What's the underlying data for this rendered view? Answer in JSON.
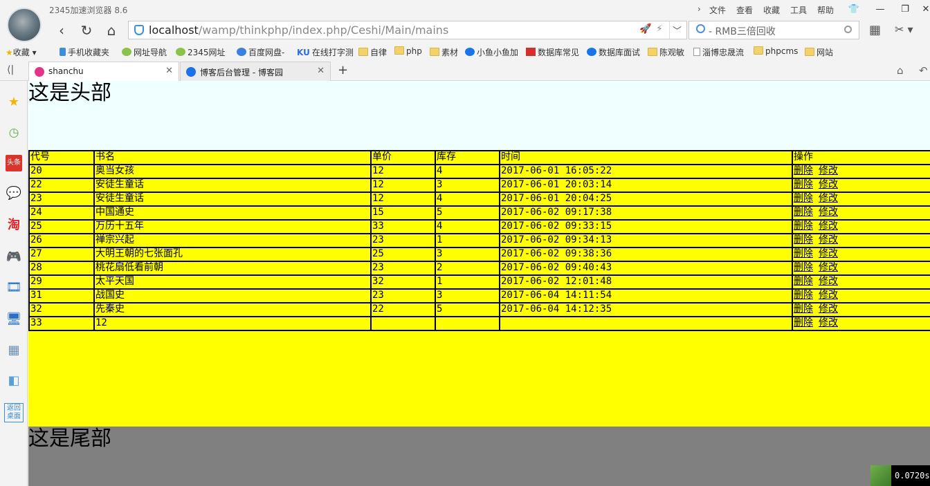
{
  "browser": {
    "title": "2345加速浏览器 8.6",
    "menu": [
      "文件",
      "查看",
      "收藏",
      "工具",
      "帮助"
    ],
    "address": {
      "host": "localhost",
      "path": "/wamp/thinkphp/index.php/Ceshi/Main/mains"
    },
    "search_placeholder": "- RMB三倍回收",
    "bookmarks": [
      "收藏",
      "手机收藏夹",
      "网址导航",
      "2345网址",
      "百度网盘-",
      "在线打字测",
      "自律",
      "php",
      "素材",
      "小鱼小鱼加",
      "数据库常见",
      "数据库面试",
      "陈观敏",
      "淄博忠晟流",
      "phpcms",
      "网站"
    ],
    "tabs": [
      {
        "label": "shanchu",
        "active": true
      },
      {
        "label": "博客后台管理 - 博客园",
        "active": false
      }
    ],
    "sidebar_icons": [
      "star-icon",
      "clock-icon",
      "toutiao-icon",
      "wechat-icon",
      "taobao-icon",
      "gamepad-icon",
      "video-icon",
      "computer-icon",
      "calculator-icon",
      "eraser-icon",
      "desktop-icon"
    ],
    "sidebar_desktop_label": "返回桌面"
  },
  "page": {
    "header_text": "这是头部",
    "footer_text": "这是尾部",
    "table": {
      "headers": [
        "代号",
        "书名",
        "单价",
        "库存",
        "时间",
        "操作"
      ],
      "rows": [
        [
          "20",
          "奥当女孩",
          "12",
          "4",
          "2017-06-01 16:05:22"
        ],
        [
          "22",
          "安徒生童话",
          "12",
          "3",
          "2017-06-01 20:03:14"
        ],
        [
          "23",
          "安徒生童话",
          "12",
          "4",
          "2017-06-01 20:04:25"
        ],
        [
          "24",
          "中国通史",
          "15",
          "5",
          "2017-06-02 09:17:38"
        ],
        [
          "25",
          "万历十五年",
          "33",
          "4",
          "2017-06-02 09:33:15"
        ],
        [
          "26",
          "禅宗兴起",
          "23",
          "1",
          "2017-06-02 09:34:13"
        ],
        [
          "27",
          "大明王朝的七张面孔",
          "25",
          "3",
          "2017-06-02 09:38:36"
        ],
        [
          "28",
          "桃花扇低看前朝",
          "23",
          "2",
          "2017-06-02 09:40:43"
        ],
        [
          "29",
          "太平天国",
          "32",
          "1",
          "2017-06-02 12:01:48"
        ],
        [
          "31",
          "战国史",
          "23",
          "3",
          "2017-06-04 14:11:54"
        ],
        [
          "32",
          "先秦史",
          "22",
          "5",
          "2017-06-04 14:12:35"
        ],
        [
          "33",
          "12",
          "",
          "",
          ""
        ]
      ],
      "delete_label": "删除",
      "edit_label": "修改"
    },
    "timer": "0.0720s"
  },
  "colors": {
    "header_bg": "#f0ffff",
    "main_bg": "#ffff00",
    "footer_bg": "#808080"
  }
}
